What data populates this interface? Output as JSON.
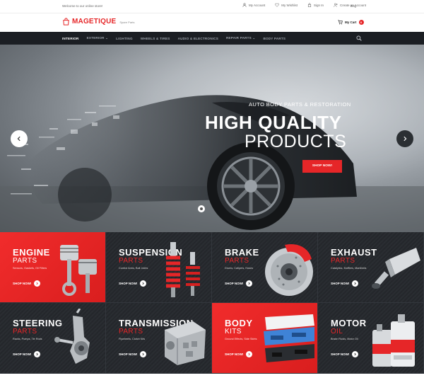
{
  "topbar": {
    "welcome": "Welcome to our online store!",
    "my_account": "My Account",
    "my_wishlist": "My Wishlist",
    "sign_in": "Sign In",
    "create_account": "Create an Account",
    "language": "Eng"
  },
  "header": {
    "logo_name": "MAGETIQUE",
    "logo_tagline": "Spare Parts",
    "cart_label": "My Cart",
    "cart_count": "0"
  },
  "nav": {
    "items": [
      {
        "label": "INTERIOR"
      },
      {
        "label": "EXTERIOR ⌄"
      },
      {
        "label": "LIGHTING"
      },
      {
        "label": "WHEELS & TIRES"
      },
      {
        "label": "AUDIO & ELECTRONICS"
      },
      {
        "label": "REPAIR PARTS ⌄"
      },
      {
        "label": "BODY PARTS"
      }
    ]
  },
  "hero": {
    "kicker": "AUTO BODY PARTS & RESTORATION",
    "headline_bold": "HIGH QUALITY",
    "headline_light": "PRODUCTS",
    "cta": "SHOP NOW!"
  },
  "categories": [
    {
      "title": "ENGINE",
      "subtitle": "PARTS",
      "desc": "Sensors, Gaskets, Oil Filters",
      "shop": "SHOP NOW!",
      "icon": "piston-icon"
    },
    {
      "title": "SUSPENSION",
      "subtitle": "PARTS",
      "desc": "Control Arms, Ball Joints",
      "shop": "SHOP NOW!",
      "icon": "shock-absorber-icon"
    },
    {
      "title": "BRAKE",
      "subtitle": "PARTS",
      "desc": "Drums, Calipers, Hoses",
      "shop": "SHOP NOW!",
      "icon": "brake-disc-icon"
    },
    {
      "title": "EXHAUST",
      "subtitle": "PARTS",
      "desc": "Catalytics, Mufflers, Manifolds",
      "shop": "SHOP NOW!",
      "icon": "muffler-icon"
    },
    {
      "title": "STEERING",
      "subtitle": "PARTS",
      "desc": "Racks, Pumps, Tie Rods",
      "shop": "SHOP NOW!",
      "icon": "steering-knuckle-icon"
    },
    {
      "title": "TRANSMISSION",
      "subtitle": "PARTS",
      "desc": "Flywheels, Clutch Kits",
      "shop": "SHOP NOW!",
      "icon": "gearbox-icon"
    },
    {
      "title": "BODY",
      "subtitle": "KITS",
      "desc": "Ground Effects, Side Skirts",
      "shop": "SHOP NOW!",
      "icon": "bumper-icon"
    },
    {
      "title": "MOTOR",
      "subtitle": "OIL",
      "desc": "Brake Fluids, Motor Oil",
      "shop": "SHOP NOW!",
      "icon": "oil-bottle-icon"
    }
  ],
  "colors": {
    "accent": "#e62628",
    "nav_bg": "#1b1e23",
    "tile_dark": "#2a2d32"
  }
}
